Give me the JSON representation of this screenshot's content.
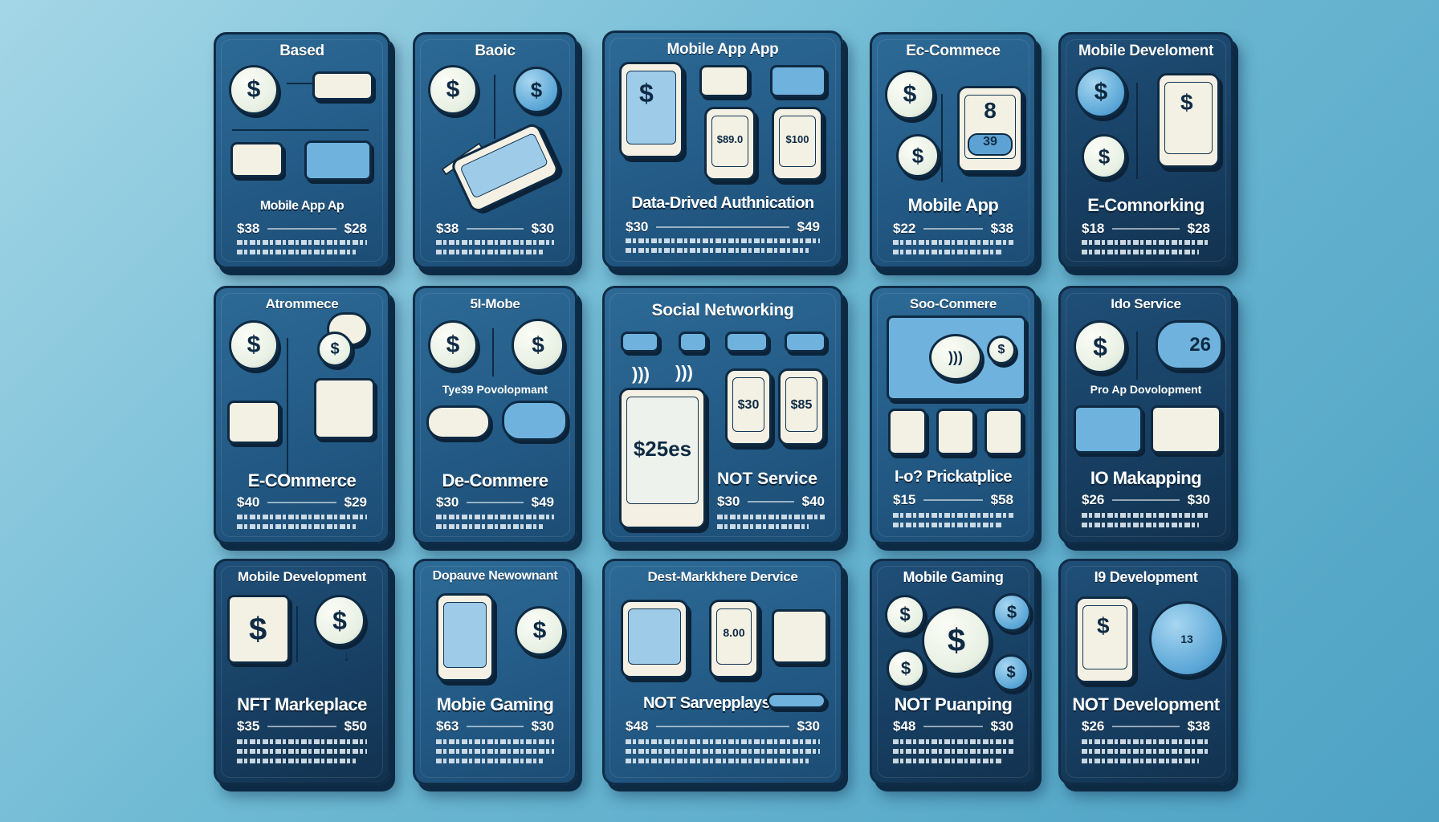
{
  "cards": [
    {
      "title": "Based",
      "subtitle": "Mobile App Ap",
      "price_left": "$38",
      "price_right": "$28"
    },
    {
      "title": "Baoic",
      "subtitle": "",
      "price_left": "$38",
      "price_right": "$30"
    },
    {
      "title": "Mobile App App",
      "subtitle": "Data-Drived Authnication",
      "price_left": "$30",
      "price_right": "$49",
      "screen_a": "$89.0",
      "screen_b": "$100"
    },
    {
      "title": "Ec-Commece",
      "subtitle": "Mobile App",
      "price_left": "$22",
      "price_right": "$38",
      "screen_num": "8",
      "screen_btn": "39"
    },
    {
      "title": "Mobile Develoment",
      "subtitle": "E-Comnorking",
      "price_left": "$18",
      "price_right": "$28"
    },
    {
      "title": "Atrommece",
      "subtitle": "E-COmmerce",
      "price_left": "$40",
      "price_right": "$29"
    },
    {
      "title": "5I-Mobe",
      "subtitle": "De-Commere",
      "mid_label": "Tye39 Povolopmant",
      "price_left": "$30",
      "price_right": "$49"
    },
    {
      "title": "Social Networking",
      "subtitle": "NOT Service",
      "price_left": "$30",
      "price_right": "$40",
      "big_price": "$25es",
      "phone_a": "$30",
      "phone_b": "$85"
    },
    {
      "title": "Soo-Conmere",
      "subtitle": "I-o? Prickatplice",
      "price_left": "$15",
      "price_right": "$58"
    },
    {
      "title": "Ido Service",
      "subtitle": "IO Makapping",
      "mid_label": "Pro Ap Dovolopment",
      "price_left": "$26",
      "price_right": "$30",
      "cloud_num": "26"
    },
    {
      "title": "Mobile Development",
      "subtitle": "NFT Markeplace",
      "price_left": "$35",
      "price_right": "$50"
    },
    {
      "title": "Dopauve Newownant",
      "subtitle": "Mobie Gaming",
      "price_left": "$63",
      "price_right": "$30"
    },
    {
      "title": "Dest-Markkhere Dervice",
      "subtitle": "NOT Sarvepplays",
      "price_left": "$48",
      "price_right": "$30",
      "screen_a": "8.00"
    },
    {
      "title": "Mobile Gaming",
      "subtitle": "NOT Puanping",
      "price_left": "$48",
      "price_right": "$30"
    },
    {
      "title": "I9 Development",
      "subtitle": "NOT Development",
      "price_left": "$26",
      "price_right": "$38",
      "globe_num": "13"
    }
  ],
  "icons": {
    "currency": "dollar-coin-icon",
    "device": "smartphone-icon",
    "cloud": "cloud-icon",
    "calendar": "calendar-icon",
    "wifi": "wifi-icon",
    "truck": "truck-icon",
    "globe": "globe-icon",
    "pen": "pen-icon",
    "arrow": "arrow-down-icon"
  },
  "colors": {
    "card_bg": "#235b86",
    "card_border": "#0f2c47",
    "coin": "#eef3e6",
    "accent": "#6fb2dd",
    "page_bg": "#6eb9d3"
  }
}
